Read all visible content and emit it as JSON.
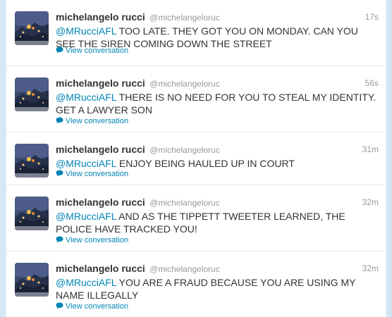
{
  "tweets": [
    {
      "fullname": "michelangelo rucci",
      "username": "@michelangeloruc",
      "time": "17s",
      "mention": "@MRucciAFL",
      "text": " TOO LATE. THEY GOT YOU ON MONDAY. CAN YOU SEE THE SIREN COMING DOWN THE STREET",
      "action": "View conversation"
    },
    {
      "fullname": "michelangelo rucci",
      "username": "@michelangeloruc",
      "time": "56s",
      "mention": "@MRucciAFL",
      "text": " THERE IS NO NEED FOR YOU TO STEAL MY IDENTITY. GET A LAWYER SON",
      "action": "View conversation"
    },
    {
      "fullname": "michelangelo rucci",
      "username": "@michelangeloruc",
      "time": "31m",
      "mention": "@MRucciAFL",
      "text": " ENJOY BEING HAULED UP IN COURT",
      "action": "View conversation"
    },
    {
      "fullname": "michelangelo rucci",
      "username": "@michelangeloruc",
      "time": "32m",
      "mention": "@MRucciAFL",
      "text": " AND AS THE TIPPETT TWEETER LEARNED, THE POLICE HAVE TRACKED YOU!",
      "action": "View conversation"
    },
    {
      "fullname": "michelangelo rucci",
      "username": "@michelangeloruc",
      "time": "32m",
      "mention": "@MRucciAFL",
      "text": " YOU ARE A FRAUD BECAUSE YOU ARE USING MY NAME ILLEGALLY",
      "action": "View conversation"
    }
  ],
  "colors": {
    "link": "#0084b4",
    "text": "#333333",
    "muted": "#999999",
    "background": "#d4e9f4"
  },
  "icons": {
    "avatar": "night-city-photo",
    "action": "speech-bubble-icon"
  }
}
